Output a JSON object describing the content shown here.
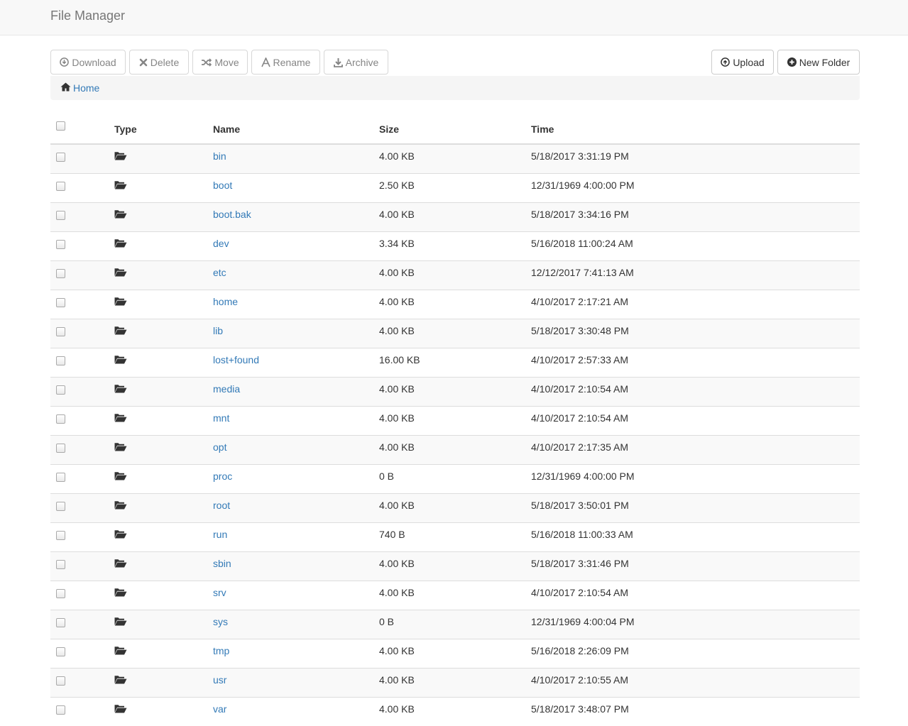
{
  "app": {
    "title": "File Manager"
  },
  "toolbar": {
    "download": "Download",
    "delete": "Delete",
    "move": "Move",
    "rename": "Rename",
    "archive": "Archive",
    "upload": "Upload",
    "new_folder": "New Folder"
  },
  "breadcrumb": {
    "home": "Home"
  },
  "table": {
    "headers": {
      "type": "Type",
      "name": "Name",
      "size": "Size",
      "time": "Time"
    },
    "rows": [
      {
        "type_icon": "folder-open-icon",
        "name": "bin",
        "size": "4.00 KB",
        "time": "5/18/2017 3:31:19 PM"
      },
      {
        "type_icon": "folder-open-icon",
        "name": "boot",
        "size": "2.50 KB",
        "time": "12/31/1969 4:00:00 PM"
      },
      {
        "type_icon": "folder-open-icon",
        "name": "boot.bak",
        "size": "4.00 KB",
        "time": "5/18/2017 3:34:16 PM"
      },
      {
        "type_icon": "folder-open-icon",
        "name": "dev",
        "size": "3.34 KB",
        "time": "5/16/2018 11:00:24 AM"
      },
      {
        "type_icon": "folder-open-icon",
        "name": "etc",
        "size": "4.00 KB",
        "time": "12/12/2017 7:41:13 AM"
      },
      {
        "type_icon": "folder-open-icon",
        "name": "home",
        "size": "4.00 KB",
        "time": "4/10/2017 2:17:21 AM"
      },
      {
        "type_icon": "folder-open-icon",
        "name": "lib",
        "size": "4.00 KB",
        "time": "5/18/2017 3:30:48 PM"
      },
      {
        "type_icon": "folder-open-icon",
        "name": "lost+found",
        "size": "16.00 KB",
        "time": "4/10/2017 2:57:33 AM"
      },
      {
        "type_icon": "folder-open-icon",
        "name": "media",
        "size": "4.00 KB",
        "time": "4/10/2017 2:10:54 AM"
      },
      {
        "type_icon": "folder-open-icon",
        "name": "mnt",
        "size": "4.00 KB",
        "time": "4/10/2017 2:10:54 AM"
      },
      {
        "type_icon": "folder-open-icon",
        "name": "opt",
        "size": "4.00 KB",
        "time": "4/10/2017 2:17:35 AM"
      },
      {
        "type_icon": "folder-open-icon",
        "name": "proc",
        "size": "0 B",
        "time": "12/31/1969 4:00:00 PM"
      },
      {
        "type_icon": "folder-open-icon",
        "name": "root",
        "size": "4.00 KB",
        "time": "5/18/2017 3:50:01 PM"
      },
      {
        "type_icon": "folder-open-icon",
        "name": "run",
        "size": "740 B",
        "time": "5/16/2018 11:00:33 AM"
      },
      {
        "type_icon": "folder-open-icon",
        "name": "sbin",
        "size": "4.00 KB",
        "time": "5/18/2017 3:31:46 PM"
      },
      {
        "type_icon": "folder-open-icon",
        "name": "srv",
        "size": "4.00 KB",
        "time": "4/10/2017 2:10:54 AM"
      },
      {
        "type_icon": "folder-open-icon",
        "name": "sys",
        "size": "0 B",
        "time": "12/31/1969 4:00:04 PM"
      },
      {
        "type_icon": "folder-open-icon",
        "name": "tmp",
        "size": "4.00 KB",
        "time": "5/16/2018 2:26:09 PM"
      },
      {
        "type_icon": "folder-open-icon",
        "name": "usr",
        "size": "4.00 KB",
        "time": "4/10/2017 2:10:55 AM"
      },
      {
        "type_icon": "folder-open-icon",
        "name": "var",
        "size": "4.00 KB",
        "time": "5/18/2017 3:48:07 PM"
      }
    ]
  },
  "colors": {
    "link": "#337ab7",
    "navbar_bg": "#f8f8f8",
    "stripe": "#f9f9f9"
  }
}
